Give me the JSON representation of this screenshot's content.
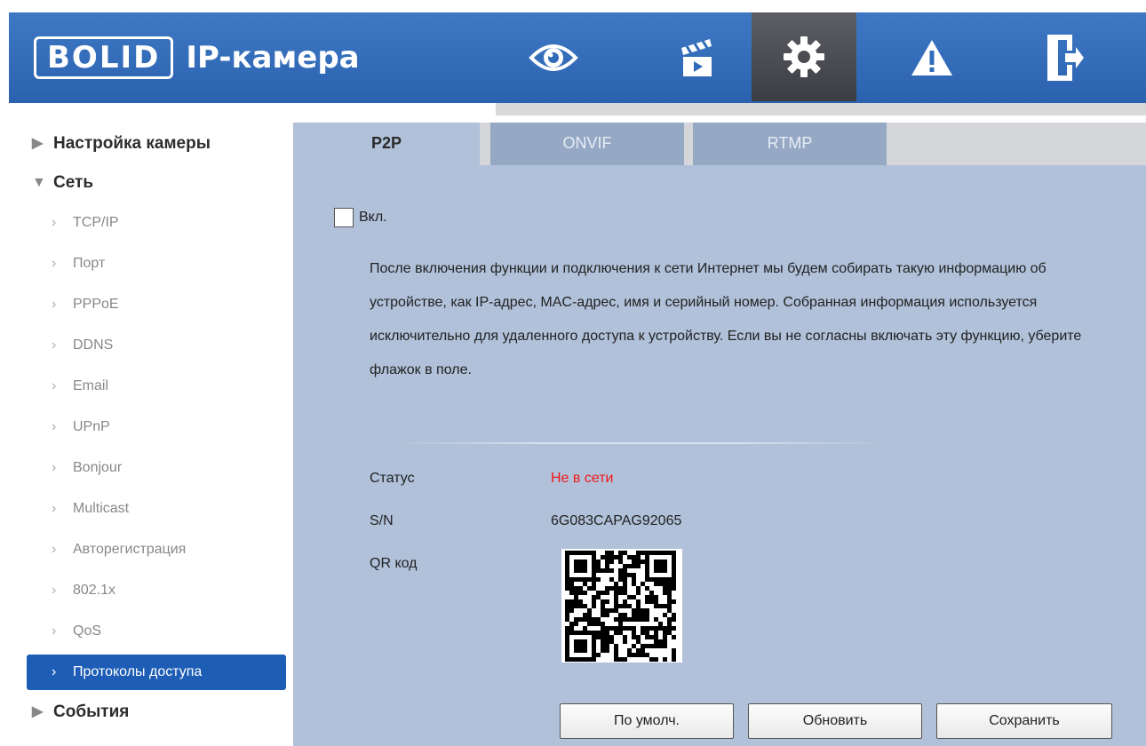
{
  "header": {
    "logo_brand": "BOLID",
    "logo_product": "IP-камера",
    "nav_icons": [
      "eye-icon",
      "clapperboard-icon",
      "gear-icon",
      "warning-icon",
      "logout-icon"
    ],
    "active_nav": "gear-icon",
    "colors": {
      "header_bg": "#2f6bb8",
      "active_nav_bg": "#4b4c52"
    }
  },
  "sidebar": {
    "groups": [
      {
        "label": "Настройка камеры",
        "expanded": false
      },
      {
        "label": "Сеть",
        "expanded": true
      },
      {
        "label": "События",
        "expanded": false
      }
    ],
    "items": [
      {
        "label": "TCP/IP"
      },
      {
        "label": "Порт"
      },
      {
        "label": "PPPoE"
      },
      {
        "label": "DDNS"
      },
      {
        "label": "Email"
      },
      {
        "label": "UPnP"
      },
      {
        "label": "Bonjour"
      },
      {
        "label": "Multicast"
      },
      {
        "label": "Авторегистрация"
      },
      {
        "label": "802.1x"
      },
      {
        "label": "QoS"
      },
      {
        "label": "Протоколы доступа"
      }
    ],
    "active_item": "Протоколы доступа",
    "colors": {
      "active_bg": "#1e5db5"
    }
  },
  "tabs": [
    {
      "label": "P2P",
      "active": true
    },
    {
      "label": "ONVIF",
      "active": false
    },
    {
      "label": "RTMP",
      "active": false
    }
  ],
  "p2p": {
    "enable_label": "Вкл.",
    "enabled": false,
    "notice": "После включения функции и подключения к сети Интернет мы будем собирать такую информацию об устройстве, как IP-адрес, MAC-адрес, имя и серийный номер. Собранная информация используется исключительно для удаленного доступа к устройству. Если вы не согласны включать эту функцию, уберите флажок в поле.",
    "status_label": "Статус",
    "status_value": "Не в сети",
    "status_color": "#f01818",
    "sn_label": "S/N",
    "sn_value": "6G083CAPAG92065",
    "qr_label": "QR код"
  },
  "buttons": {
    "default_label": "По умолч.",
    "refresh_label": "Обновить",
    "save_label": "Сохранить"
  }
}
